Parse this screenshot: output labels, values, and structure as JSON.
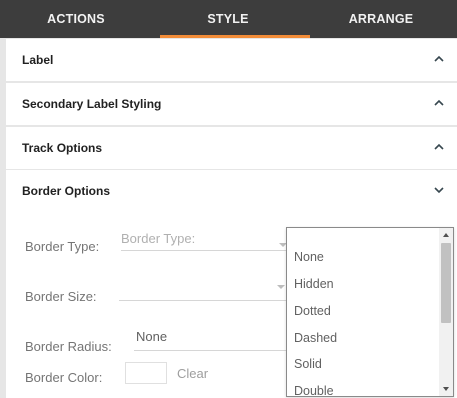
{
  "tabs": [
    {
      "label": "ACTIONS"
    },
    {
      "label": "STYLE"
    },
    {
      "label": "ARRANGE"
    }
  ],
  "active_tab": "STYLE",
  "accent_color": "#f28c38",
  "sections": [
    {
      "title": "Label",
      "state": "collapsed",
      "icon": "chevron-up-icon"
    },
    {
      "title": "Secondary Label Styling",
      "state": "collapsed",
      "icon": "chevron-up-icon"
    },
    {
      "title": "Track Options",
      "state": "collapsed",
      "icon": "chevron-up-icon"
    },
    {
      "title": "Border Options",
      "state": "expanded",
      "icon": "chevron-down-icon"
    }
  ],
  "border_options": {
    "border_type_label": "Border Type:",
    "border_type_placeholder": "Border Type:",
    "border_size_label": "Border Size:",
    "border_radius_label": "Border Radius:",
    "border_radius_value": "None",
    "border_color_label": "Border Color:",
    "clear_label": "Clear"
  },
  "dropdown": {
    "options": [
      "None",
      "Hidden",
      "Dotted",
      "Dashed",
      "Solid",
      "Double"
    ]
  }
}
